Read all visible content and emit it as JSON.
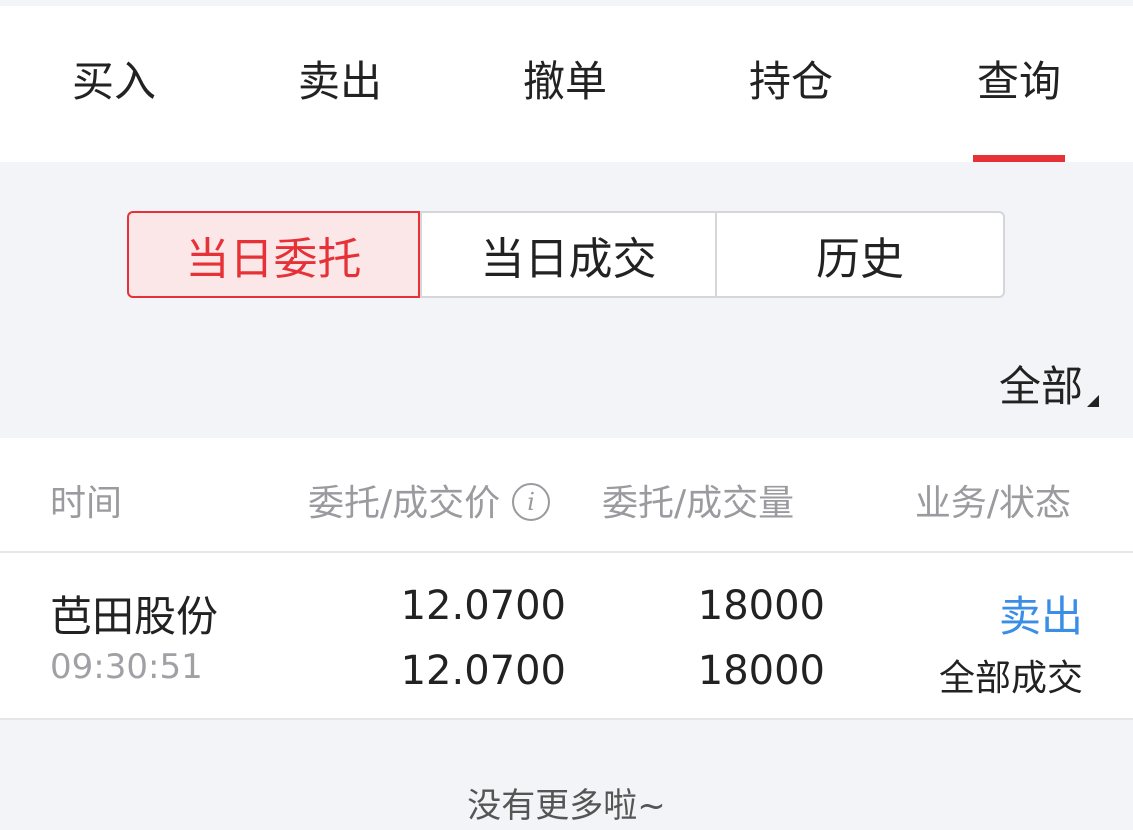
{
  "tabs": [
    {
      "label": "买入"
    },
    {
      "label": "卖出"
    },
    {
      "label": "撤单"
    },
    {
      "label": "持仓"
    },
    {
      "label": "查询"
    }
  ],
  "active_tab": "查询",
  "segments": [
    {
      "label": "当日委托"
    },
    {
      "label": "当日成交"
    },
    {
      "label": "历史"
    }
  ],
  "active_segment": "当日委托",
  "filter": {
    "label": "全部"
  },
  "table": {
    "headers": {
      "time": "时间",
      "price": "委托/成交价",
      "volume": "委托/成交量",
      "status": "业务/状态"
    },
    "info_icon": "i",
    "rows": [
      {
        "name": "芭田股份",
        "time": "09:30:51",
        "order_price": "12.0700",
        "deal_price": "12.0700",
        "order_volume": "18000",
        "deal_volume": "18000",
        "business": "卖出",
        "status": "全部成交"
      }
    ]
  },
  "footer": {
    "note": "没有更多啦~"
  },
  "colors": {
    "accent_red": "#e63237",
    "link_blue": "#3a8ee6",
    "background": "#f3f4f7"
  }
}
